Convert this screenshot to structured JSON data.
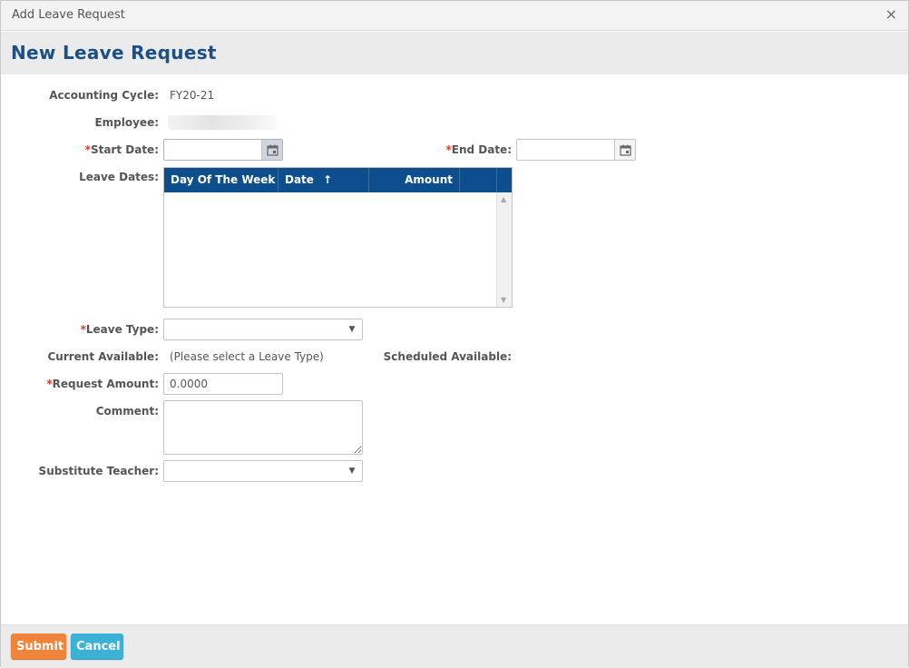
{
  "window": {
    "title": "Add Leave Request",
    "close_glyph": "×"
  },
  "page": {
    "title": "New Leave Request"
  },
  "form": {
    "accounting_cycle_label": "Accounting Cycle:",
    "accounting_cycle_value": "FY20-21",
    "employee_label": "Employee:",
    "required_mark": "*",
    "start_date_label": "Start Date:",
    "start_date_value": "",
    "end_date_label": "End Date:",
    "end_date_value": "",
    "leave_dates_label": "Leave Dates:",
    "leave_type_label": "Leave Type:",
    "leave_type_value": "",
    "current_available_label": "Current Available:",
    "current_available_value": "(Please select a Leave Type)",
    "scheduled_available_label": "Scheduled Available:",
    "request_amount_label": "Request Amount:",
    "request_amount_value": "0.0000",
    "comment_label": "Comment:",
    "comment_value": "",
    "substitute_label": "Substitute Teacher:",
    "substitute_value": ""
  },
  "grid": {
    "columns": [
      "Day Of The Week",
      "Date",
      "Amount"
    ],
    "sort_glyph": "↑",
    "rows": []
  },
  "icons": {
    "calendar": "calendar-icon",
    "dropdown": "dropdown-arrow-icon",
    "scroll_up": "▲",
    "scroll_down": "▼",
    "dropdown_glyph": "▼"
  },
  "footer": {
    "submit_label": "Submit",
    "cancel_label": "Cancel"
  },
  "colors": {
    "title_blue": "#1b4f86",
    "grid_header": "#0d4e8c",
    "submit": "#f0843a",
    "cancel": "#3ab1d5",
    "required": "#e0362a"
  }
}
